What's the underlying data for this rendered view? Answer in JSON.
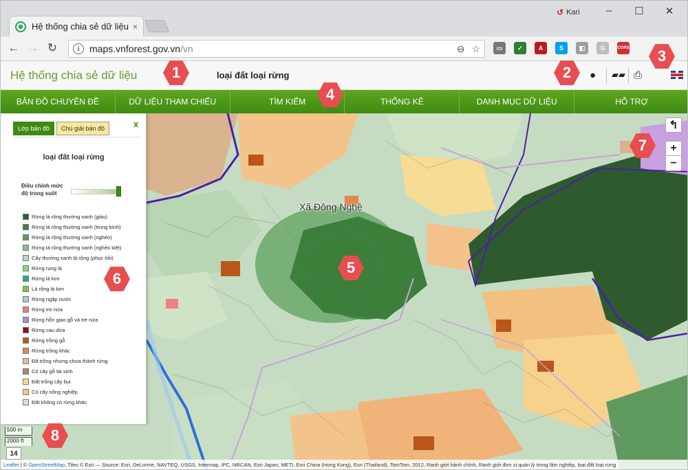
{
  "browser": {
    "tab_title": "Hệ thống chia sẻ dữ liệu",
    "tab_close": "×",
    "user_name": "Kari",
    "url_host": "maps.vnforest.gov.vn",
    "url_path": "/vn",
    "window_controls": {
      "minimize": "–",
      "maximize": "☐",
      "close": "✕"
    },
    "extensions": [
      {
        "name": "cast-icon",
        "color": "#777777",
        "glyph": "▭"
      },
      {
        "name": "checklist-extension-icon",
        "color": "#2e7d32",
        "glyph": "✓"
      },
      {
        "name": "pdf-extension-icon",
        "color": "#b71c1c",
        "glyph": "A"
      },
      {
        "name": "skype-extension-icon",
        "color": "#00a2ed",
        "glyph": "S"
      },
      {
        "name": "puzzle-extension-icon",
        "color": "#9e9e9e",
        "glyph": "◧"
      },
      {
        "name": "g-extension-icon",
        "color": "#bdbdbd",
        "glyph": "G"
      },
      {
        "name": "cors-extension-icon",
        "color": "#d32f2f",
        "glyph": "CORS"
      }
    ]
  },
  "header": {
    "site_title": "Hệ thống chia sẻ dữ liệu",
    "map_title": "loại đất loại rừng"
  },
  "nav": {
    "items": [
      "BẢN ĐỒ CHUYÊN ĐỀ",
      "DỮ LIỆU THAM CHIẾU",
      "TÌM KIẾM",
      "THỐNG KÊ",
      "DANH MỤC DỮ LIỆU",
      "HỖ TRỢ"
    ]
  },
  "panel": {
    "tab_layers": "Lớp bản đồ",
    "tab_legend": "Chú giải bản đồ",
    "close": "x",
    "title": "loại đất loại rừng",
    "opacity_label": "Điều chỉnh mức độ trong suốt",
    "opacity_value": 0.95,
    "legend": [
      {
        "label": "Rừng lá rộng thường xanh (giàu)",
        "color": "#2f5f2f"
      },
      {
        "label": "Rừng lá rộng thường xanh (trung bình)",
        "color": "#3f7f3f"
      },
      {
        "label": "Rừng lá rộng thường xanh (nghèo)",
        "color": "#5e9a5e"
      },
      {
        "label": "Rừng lá rộng thường xanh (nghèo kiệt)",
        "color": "#8fbc8f"
      },
      {
        "label": "Cây thường xanh lá rộng (phục hồi)",
        "color": "#b9d9b9"
      },
      {
        "label": "Rừng rụng lá",
        "color": "#7ee07e"
      },
      {
        "label": "Rừng lá kim",
        "color": "#22b07a"
      },
      {
        "label": "Lá rộng lá kim",
        "color": "#8dbf3c"
      },
      {
        "label": "Rừng ngập nước",
        "color": "#9fd4c8"
      },
      {
        "label": "Rừng tre nứa",
        "color": "#f08080"
      },
      {
        "label": "Rừng hỗn giao gỗ và tre nứa",
        "color": "#a98fd8"
      },
      {
        "label": "Rừng cau dừa",
        "color": "#8b1030"
      },
      {
        "label": "Rừng trồng gỗ",
        "color": "#b8561c"
      },
      {
        "label": "Rừng trồng khác",
        "color": "#e0894a"
      },
      {
        "label": "Đã trồng nhưng chưa thành rừng",
        "color": "#e8b9a0"
      },
      {
        "label": "Có cây gỗ tái sinh",
        "color": "#b08070"
      },
      {
        "label": "Đất trống cây bụi",
        "color": "#f5d98a"
      },
      {
        "label": "Có cây nông nghiệp",
        "color": "#f5c58a"
      },
      {
        "label": "Đất không có rừng khác",
        "color": "#dcdcdc"
      }
    ]
  },
  "map": {
    "place_label": "Xã Đông Nghệ",
    "zoom_in": "+",
    "zoom_out": "−",
    "back": "↰",
    "scale_m": "500 m",
    "scale_ft": "2000 ft",
    "zoom_level": "14",
    "attribution_leaflet": "Leaflet",
    "attribution_osm": "OpenStreetMap",
    "attribution_text_a": " | © ",
    "attribution_text_b": ", Tiles © Esri — Source: Esri, DeLorme, NAVTEQ, USGS, Intermap, iPC, NRCAN, Esri Japan, METI, Esri China (Hong Kong), Esri (Thailand), TomTom, 2012, Ranh giới hành chính, Ranh giới đơn vị quản lý trong lâm nghiệp, loại đất loại rừng"
  },
  "callouts": [
    "1",
    "2",
    "3",
    "4",
    "5",
    "6",
    "7",
    "8"
  ]
}
